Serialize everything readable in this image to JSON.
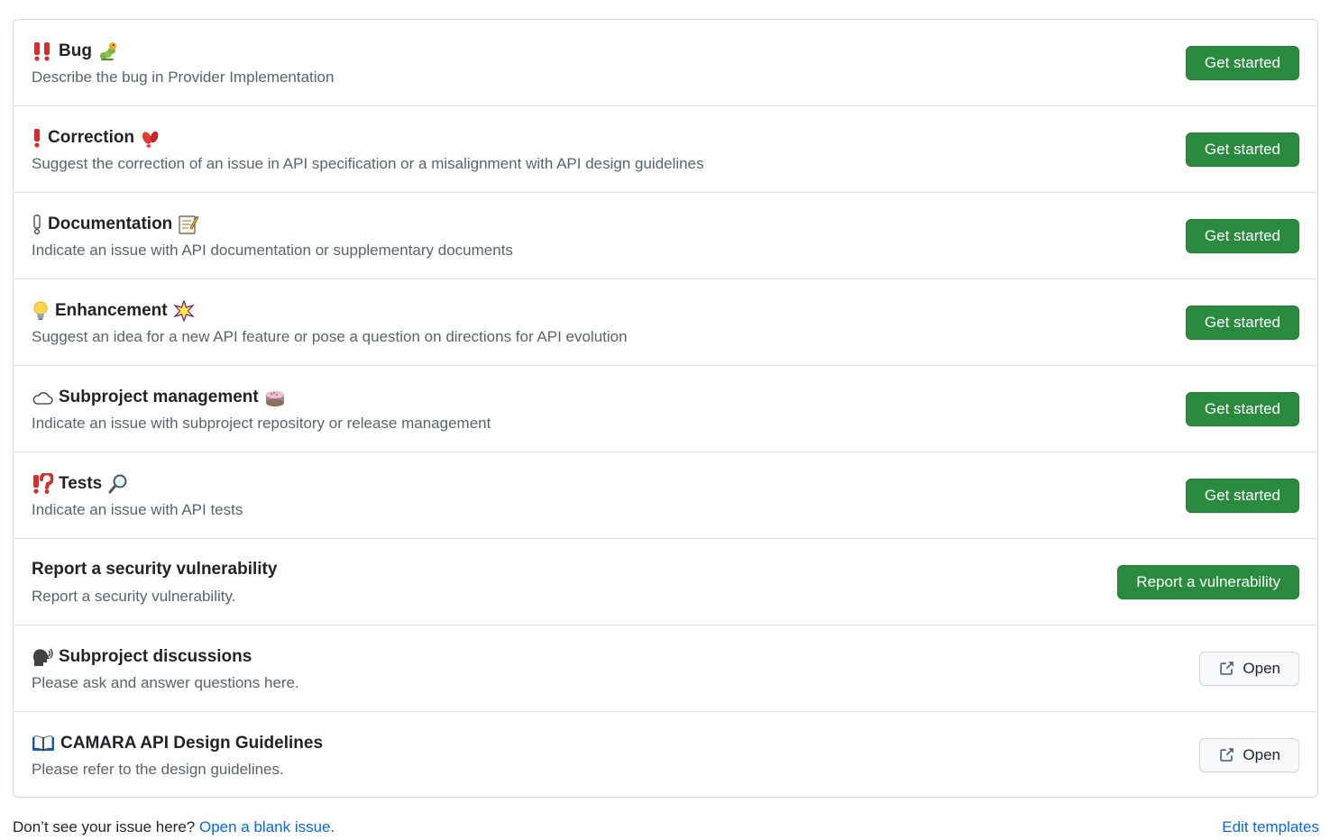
{
  "templates": [
    {
      "title": "Bug",
      "description": "Describe the bug in Provider Implementation",
      "button": "Get started",
      "icons": [
        "double-exclamation-icon",
        "bug-icon"
      ]
    },
    {
      "title": "Correction",
      "description": "Suggest the correction of an issue in API specification or a misalignment with API design guidelines",
      "button": "Get started",
      "icons": [
        "red-exclamation-icon",
        "footprints-icon"
      ]
    },
    {
      "title": "Documentation",
      "description": "Indicate an issue with API documentation or supplementary documents",
      "button": "Get started",
      "icons": [
        "white-exclamation-icon",
        "memo-icon"
      ]
    },
    {
      "title": "Enhancement",
      "description": "Suggest an idea for a new API feature or pose a question on directions for API evolution",
      "button": "Get started",
      "icons": [
        "light-bulb-icon",
        "sparkle-icon"
      ]
    },
    {
      "title": "Subproject management",
      "description": "Indicate an issue with subproject repository or release management",
      "button": "Get started",
      "icons": [
        "cloud-icon",
        "cake-icon"
      ]
    },
    {
      "title": "Tests",
      "description": "Indicate an issue with API tests",
      "button": "Get started",
      "icons": [
        "exclamation-question-icon",
        "magnifier-icon"
      ]
    },
    {
      "title": "Report a security vulnerability",
      "description": "Report a security vulnerability.",
      "button": "Report a vulnerability",
      "icons": []
    },
    {
      "title": "Subproject discussions",
      "description": "Please ask and answer questions here.",
      "button": "Open",
      "icons": [
        "speaking-head-icon"
      ]
    },
    {
      "title": "CAMARA API Design Guidelines",
      "description": "Please refer to the design guidelines.",
      "button": "Open",
      "icons": [
        "open-book-icon"
      ]
    }
  ],
  "footer": {
    "prompt": "Don’t see your issue here?",
    "blank_issue_link": "Open a blank issue.",
    "edit_templates_link": "Edit templates"
  },
  "colors": {
    "primary_button": "#2a8a3e",
    "link": "#0969da",
    "border": "#d0d7de",
    "muted_text": "#59636e"
  }
}
